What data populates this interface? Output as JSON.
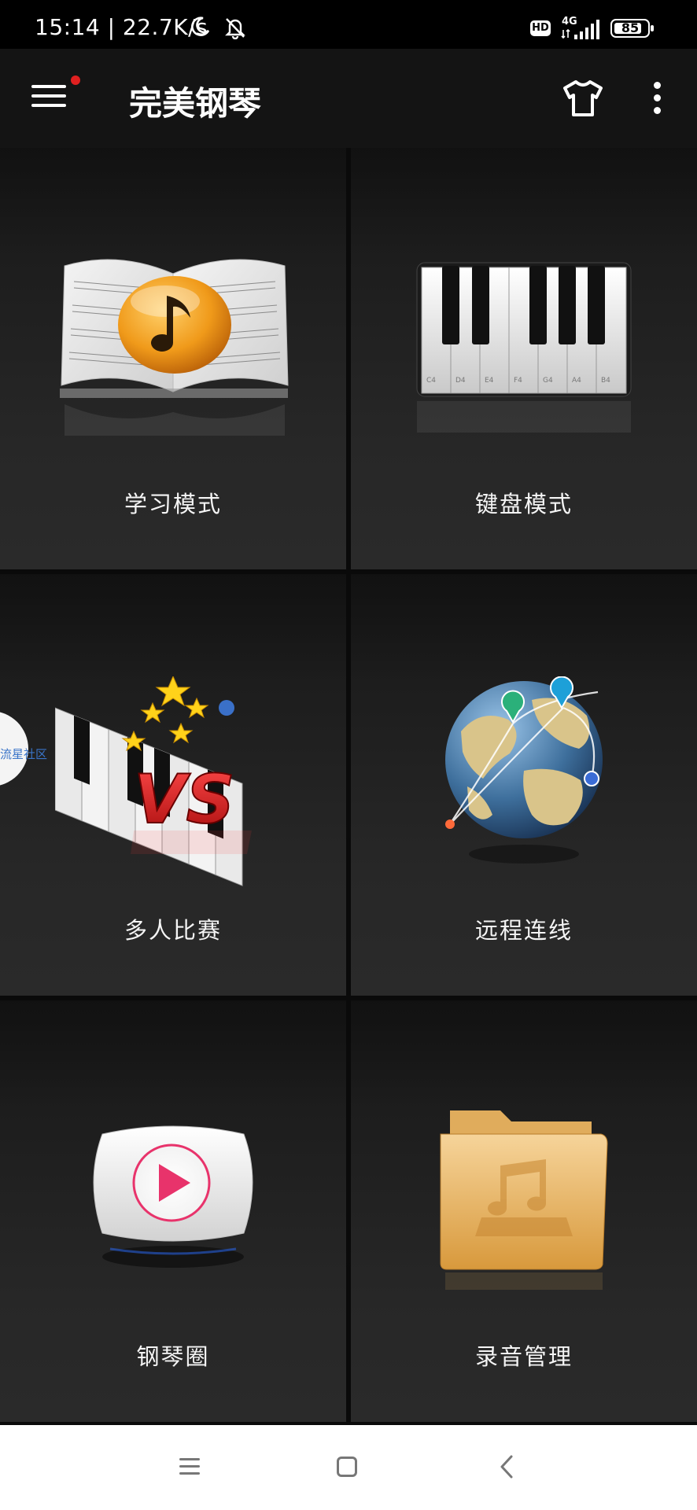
{
  "status_bar": {
    "time": "15:14 | 22.7K/s",
    "network": "4G",
    "hd": "HD",
    "battery": "85",
    "battery_level": 0.85,
    "icons": [
      "moon-icon",
      "bell-off-icon",
      "signal-icon",
      "battery-icon"
    ]
  },
  "app_bar": {
    "title": "完美钢琴",
    "menu_icon": "menu-icon",
    "notification_dot_color": "#e02020",
    "skin_icon": "shirt-icon",
    "more_icon": "overflow-icon"
  },
  "tiles": [
    {
      "label": "学习模式",
      "icon": "sheet-music-book-icon"
    },
    {
      "label": "键盘模式",
      "icon": "piano-keys-icon",
      "key_labels": [
        "C4",
        "D4",
        "E4",
        "F4",
        "G4",
        "A4",
        "B4"
      ]
    },
    {
      "label": "多人比赛",
      "icon": "piano-versus-icon",
      "badge": "VS"
    },
    {
      "label": "远程连线",
      "icon": "globe-network-icon"
    },
    {
      "label": "钢琴圈",
      "icon": "play-video-icon"
    },
    {
      "label": "录音管理",
      "icon": "music-folder-icon"
    }
  ],
  "floating_bubble": {
    "label": "流星社区"
  },
  "nav_bar": {
    "icons": [
      "nav-menu-icon",
      "nav-home-icon",
      "nav-back-icon"
    ]
  },
  "colors": {
    "background": "#0a0a0a",
    "tile": "#242424",
    "app_bar": "#141414",
    "accent_red": "#e02020",
    "play_pink": "#e8336b",
    "folder_gold": "#e7b25c"
  }
}
